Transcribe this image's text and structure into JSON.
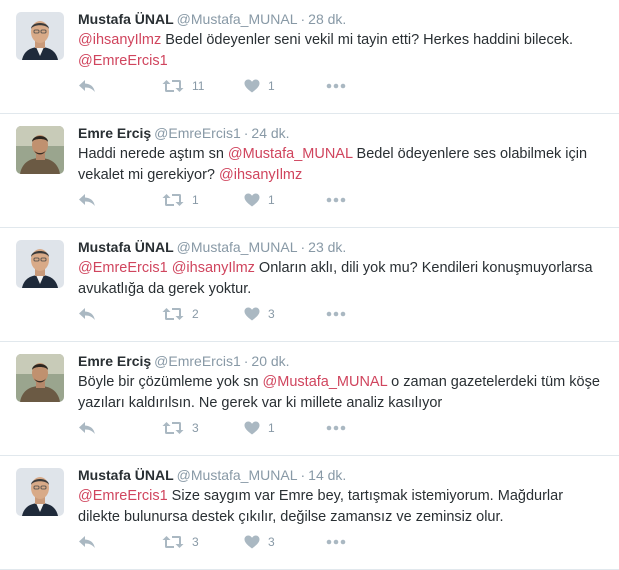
{
  "tweets": [
    {
      "fullname": "Mustafa ÜNAL",
      "username": "@Mustafa_MUNAL",
      "time": "28 dk.",
      "avatar_kind": "avatar-mustafa",
      "text": [
        {
          "type": "mention",
          "value": "@ihsanyIlmz"
        },
        {
          "type": "text",
          "value": " Bedel ödeyenler seni vekil mi tayin etti? Herkes haddini bilecek. "
        },
        {
          "type": "mention",
          "value": "@EmreErcis1"
        }
      ],
      "retweets": "11",
      "likes": "1"
    },
    {
      "fullname": "Emre Erciş",
      "username": "@EmreErcis1",
      "time": "24 dk.",
      "avatar_kind": "avatar-emre",
      "text": [
        {
          "type": "text",
          "value": "Haddi nerede aştım sn "
        },
        {
          "type": "mention",
          "value": "@Mustafa_MUNAL"
        },
        {
          "type": "text",
          "value": " Bedel ödeyenlere ses olabilmek için vekalet mi gerekiyor? "
        },
        {
          "type": "mention",
          "value": "@ihsanyIlmz"
        }
      ],
      "retweets": "1",
      "likes": "1"
    },
    {
      "fullname": "Mustafa ÜNAL",
      "username": "@Mustafa_MUNAL",
      "time": "23 dk.",
      "avatar_kind": "avatar-mustafa",
      "text": [
        {
          "type": "mention",
          "value": "@EmreErcis1"
        },
        {
          "type": "text",
          "value": " "
        },
        {
          "type": "mention",
          "value": "@ihsanyIlmz"
        },
        {
          "type": "text",
          "value": " Onların aklı, dili yok mu? Kendileri konuşmuyorlarsa avukatlığa da gerek yoktur."
        }
      ],
      "retweets": "2",
      "likes": "3"
    },
    {
      "fullname": "Emre Erciş",
      "username": "@EmreErcis1",
      "time": "20 dk.",
      "avatar_kind": "avatar-emre",
      "text": [
        {
          "type": "text",
          "value": "Böyle bir çözümleme yok sn "
        },
        {
          "type": "mention",
          "value": "@Mustafa_MUNAL"
        },
        {
          "type": "text",
          "value": " o zaman gazetelerdeki tüm köşe yazıları kaldırılsın. Ne gerek var ki millete analiz kasılıyor"
        }
      ],
      "retweets": "3",
      "likes": "1"
    },
    {
      "fullname": "Mustafa ÜNAL",
      "username": "@Mustafa_MUNAL",
      "time": "14 dk.",
      "avatar_kind": "avatar-mustafa",
      "text": [
        {
          "type": "mention",
          "value": "@EmreErcis1"
        },
        {
          "type": "text",
          "value": " Size saygım var Emre bey, tartışmak istemiyorum. Mağdurlar dilekte bulunursa destek çıkılır, değilse zamansız ve zeminsiz olur."
        }
      ],
      "retweets": "3",
      "likes": "3"
    }
  ],
  "separator": "·",
  "icons": {
    "reply": "reply-icon",
    "retweet": "retweet-icon",
    "like": "heart-icon",
    "more": "more-icon"
  },
  "colors": {
    "mention": "#d0455e",
    "meta": "#8899a6",
    "icon": "#aab8c2",
    "text": "#292f33"
  }
}
